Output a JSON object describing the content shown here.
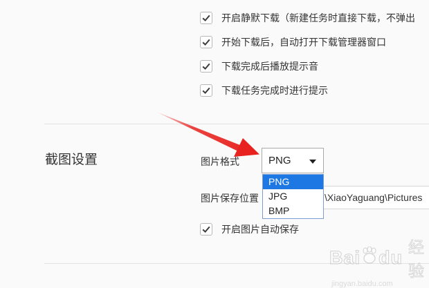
{
  "download_options": [
    {
      "label": "开启静默下载（新建任务时直接下载，不弹出",
      "checked": true
    },
    {
      "label": "开始下载后，自动打开下载管理器窗口",
      "checked": true
    },
    {
      "label": "下载完成后播放提示音",
      "checked": true
    },
    {
      "label": "下载任务完成时进行提示",
      "checked": true
    }
  ],
  "screenshot_settings": {
    "title": "截图设置",
    "format_label": "图片格式",
    "format_selected": "PNG",
    "format_options": [
      "PNG",
      "JPG",
      "BMP"
    ],
    "save_path_label": "图片保存位置",
    "save_path_value": "\\XiaoYaguang\\Pictures",
    "auto_save_label": "开启图片自动保存",
    "auto_save_checked": true
  },
  "watermark": {
    "brand": "Bai",
    "brand_suffix": "du",
    "product": "经验",
    "url": "jingyan.baidu.com"
  },
  "colors": {
    "annotation_arrow": "#e8231f",
    "option_highlight": "#1e78e4",
    "dropdown_border": "#7a9cd3"
  },
  "icons": {
    "checkbox": "checkmark-icon",
    "select": "caret-down-icon",
    "annotation": "red-arrow-icon"
  }
}
